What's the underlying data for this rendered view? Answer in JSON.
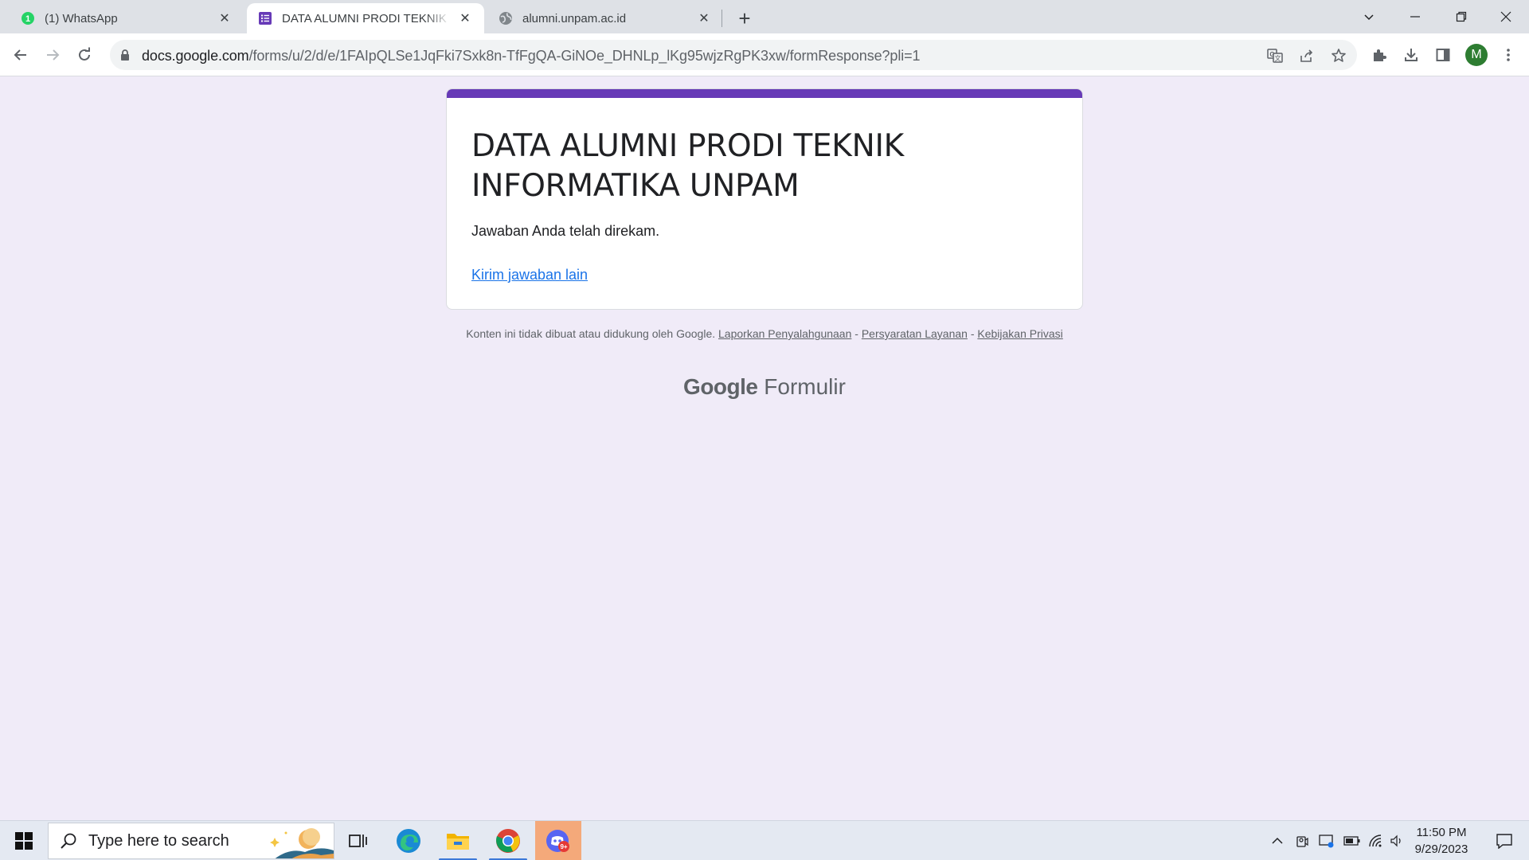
{
  "browser": {
    "tabs": [
      {
        "title": "(1) WhatsApp",
        "badge": "1",
        "icon": "whatsapp-icon",
        "active": false
      },
      {
        "title": "DATA ALUMNI PRODI TEKNIK INFORMATIKA UNPAM",
        "icon": "google-forms-icon",
        "active": true
      },
      {
        "title": "alumni.unpam.ac.id",
        "icon": "globe-icon",
        "active": false
      }
    ],
    "url_host": "docs.google.com",
    "url_path": "/forms/u/2/d/e/1FAIpQLSe1JqFki7Sxk8n-TfFgQA-GiNOe_DHNLp_lKg95wjzRgPK3xw/formResponse?pli=1",
    "profile_initial": "M",
    "profile_color": "#2e7d32"
  },
  "form": {
    "title": "DATA ALUMNI PRODI TEKNIK INFORMATIKA UNPAM",
    "confirmation": "Jawaban Anda telah direkam.",
    "another_response": "Kirim jawaban lain",
    "accent_color": "#673ab7"
  },
  "footer": {
    "disclaimer": "Konten ini tidak dibuat atau didukung oleh Google.",
    "report_abuse": "Laporkan Penyalahgunaan",
    "terms": "Persyaratan Layanan",
    "privacy": "Kebijakan Privasi",
    "sep": "-",
    "brand_google": "Google",
    "brand_product": "Formulir"
  },
  "taskbar": {
    "search_placeholder": "Type here to search",
    "time": "11:50 PM",
    "date": "9/29/2023",
    "discord_badge": "9+"
  }
}
